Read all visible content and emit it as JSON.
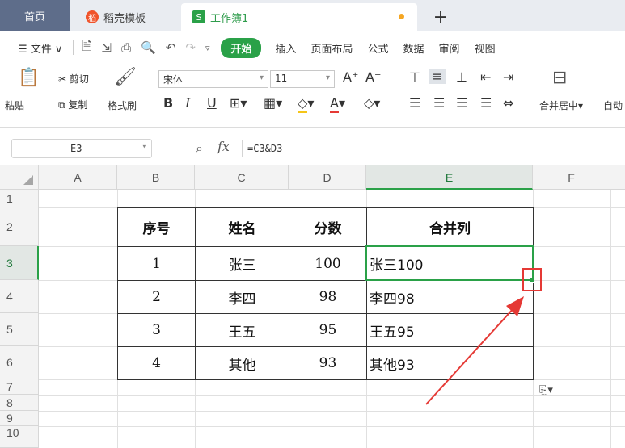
{
  "tabs": {
    "home": "首页",
    "template": "稻壳模板",
    "template_icon": "稻",
    "workbook": "工作簿1",
    "workbook_icon": "S",
    "add": "+"
  },
  "menu": {
    "file": "☰ 文件 ∨",
    "start": "开始",
    "items": [
      "插入",
      "页面布局",
      "公式",
      "数据",
      "审阅",
      "视图"
    ]
  },
  "ribbon": {
    "paste": "粘贴",
    "cut": "剪切",
    "copy": "复制",
    "format_painter": "格式刷",
    "font_name": "宋体",
    "font_size": "11",
    "merge_center": "合并居中",
    "auto": "自动"
  },
  "formula_bar": {
    "name_box": "E3",
    "fx": "fx",
    "formula": "=C3&D3"
  },
  "columns": [
    "A",
    "B",
    "C",
    "D",
    "E",
    "F"
  ],
  "rows": [
    "1",
    "2",
    "3",
    "4",
    "5",
    "6",
    "7",
    "8",
    "9",
    "10"
  ],
  "selected_column": "E",
  "selected_row": "3",
  "table": {
    "headers": [
      "序号",
      "姓名",
      "分数",
      "合并列"
    ],
    "rows": [
      [
        "1",
        "张三",
        "100",
        "张三100"
      ],
      [
        "2",
        "李四",
        "98",
        "李四98"
      ],
      [
        "3",
        "王五",
        "95",
        "王五95"
      ],
      [
        "4",
        "其他",
        "93",
        "其他93"
      ]
    ]
  },
  "colors": {
    "accent": "#2aa148",
    "annotation": "#e53935"
  }
}
